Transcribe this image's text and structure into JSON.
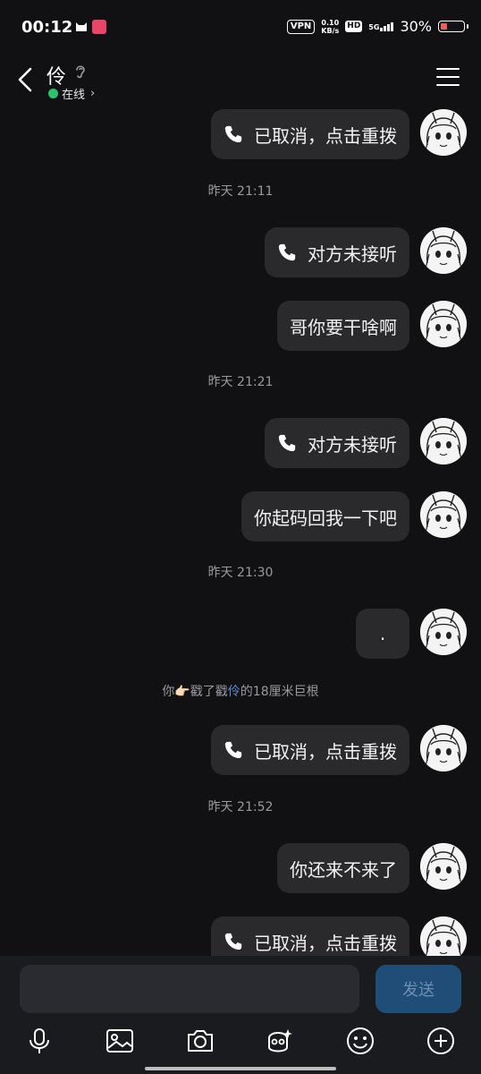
{
  "status": {
    "time": "00:12",
    "vpn": "VPN",
    "speed_value": "0.10",
    "speed_unit": "KB/s",
    "hd": "HD",
    "network": "5G",
    "battery_pct": "30%",
    "battery_level": 0.3
  },
  "header": {
    "name": "伶",
    "status": "在线"
  },
  "messages": [
    {
      "type": "call",
      "text": "已取消，点击重拨"
    },
    {
      "type": "time",
      "text": "昨天 21:11"
    },
    {
      "type": "call",
      "text": "对方未接听"
    },
    {
      "type": "text",
      "text": "哥你要干啥啊"
    },
    {
      "type": "time",
      "text": "昨天 21:21"
    },
    {
      "type": "call",
      "text": "对方未接听"
    },
    {
      "type": "text",
      "text": "你起码回我一下吧"
    },
    {
      "type": "time",
      "text": "昨天 21:30"
    },
    {
      "type": "text",
      "text": "."
    },
    {
      "type": "system",
      "pre": "你",
      "mid": "戳了戳",
      "hl": "伶",
      "post": "的18厘米巨根"
    },
    {
      "type": "call",
      "text": "已取消，点击重拨"
    },
    {
      "type": "time",
      "text": "昨天 21:52"
    },
    {
      "type": "text",
      "text": "你还来不来了"
    },
    {
      "type": "call",
      "text": "已取消，点击重拨"
    }
  ],
  "composer": {
    "placeholder": "",
    "send_label": "发送"
  },
  "toolbar": {
    "items": [
      "mic-icon",
      "image-icon",
      "camera-icon",
      "sticker-icon",
      "emoji-icon",
      "plus-icon"
    ]
  }
}
